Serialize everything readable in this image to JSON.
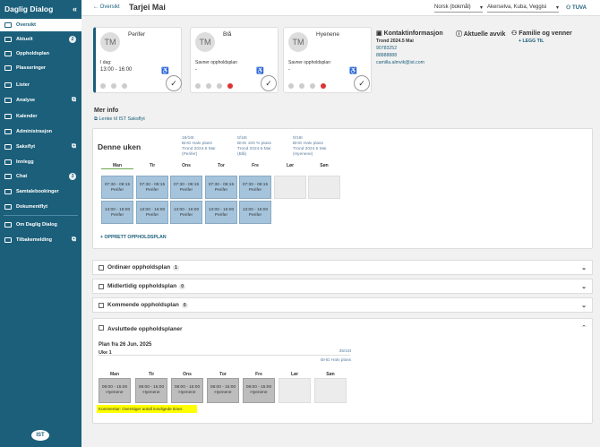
{
  "app": {
    "title": "Daglig Dialog",
    "collapse": "«"
  },
  "nav": [
    {
      "label": "Oversikt"
    },
    {
      "label": "Aktuelt",
      "badge": "2"
    },
    {
      "label": "Oppholdsplan"
    },
    {
      "label": "Plasseringer"
    },
    {
      "label": "Lister"
    },
    {
      "label": "Analyse"
    },
    {
      "label": "Kalender"
    },
    {
      "label": "Administrasjon"
    },
    {
      "label": "Saksflyt"
    },
    {
      "label": "Innlegg"
    },
    {
      "label": "Chat",
      "badge": "3"
    },
    {
      "label": "Samtalebookinger"
    },
    {
      "label": "Dokumentflyt"
    },
    {
      "label": "Om Daglig Dialog"
    },
    {
      "label": "Tilbakemelding"
    }
  ],
  "logo": "IST",
  "topbar": {
    "back": "← Oversikt",
    "title": "Tarjei Mai",
    "language": "Norsk (bokmål)",
    "location": "Akerselva, Kuba, Veggisi",
    "user": "TUVA"
  },
  "cards": [
    {
      "initials": "TM",
      "name": "Perifer",
      "line1": "I dag:",
      "line2": "13:00 - 16:00"
    },
    {
      "initials": "TM",
      "name": "Blå",
      "line1": "Savner oppholdsplan",
      "line2": "-"
    },
    {
      "initials": "TM",
      "name": "Hyenene",
      "line1": "Savner oppholdsplan",
      "line2": "-"
    }
  ],
  "contact": {
    "heading": "Kontaktinformasjon",
    "name": "Trond 2024.5 Mai",
    "phone1": "90783252",
    "phone2": "88888888",
    "email": "camilla.almvik@ist.com"
  },
  "deviations": {
    "heading": "Aktuelle avvik"
  },
  "family": {
    "heading": "Familie og venner",
    "add": "+ LEGG TIL"
  },
  "more": {
    "heading": "Mer info",
    "link": "Lenke til IST Saksflyt"
  },
  "week": {
    "heading": "Denne uken",
    "plans": [
      {
        "pct": "19/16t",
        "type": "BHG Halv plass",
        "who": "Trond 2024.5 Mai",
        "grp": "(Perifer)"
      },
      {
        "pct": "0/16t",
        "type": "BHG 100 % plass",
        "who": "Trond 2024.5 Mai",
        "grp": "(Blå)"
      },
      {
        "pct": "0/16t",
        "type": "BHG Halv plass",
        "who": "Trond 2024.5 Mai",
        "grp": "(Hyenene)"
      }
    ],
    "days": [
      "Man",
      "Tir",
      "Ons",
      "Tor",
      "Fre",
      "Lør",
      "Søn"
    ],
    "morning": {
      "time": "07:30 - 08:15",
      "grp": "Perifer"
    },
    "afternoon": {
      "time": "13:00 - 16:00",
      "grp": "Perifer"
    },
    "add": "+ OPPRETT OPPHOLDSPLAN"
  },
  "accordions": [
    {
      "label": "Ordinær oppholdsplan",
      "count": "1"
    },
    {
      "label": "Midlertidig oppholdsplan",
      "count": "0"
    },
    {
      "label": "Kommende oppholdsplan",
      "count": "0"
    }
  ],
  "closed": {
    "heading": "Avsluttede oppholdsplaner",
    "planfrom": "Plan fra 26 Jun. 2025",
    "week": "Uke 1",
    "pct": "35/16t",
    "type": "BHG Halv plass",
    "days": [
      "Man",
      "Tir",
      "Ons",
      "Tor",
      "Fre",
      "Lør",
      "Søn"
    ],
    "slot": {
      "time": "08:00 - 15:00",
      "grp": "Hyenene"
    },
    "comment": "Kommentar: Overstiger antall innvilgede timer."
  }
}
